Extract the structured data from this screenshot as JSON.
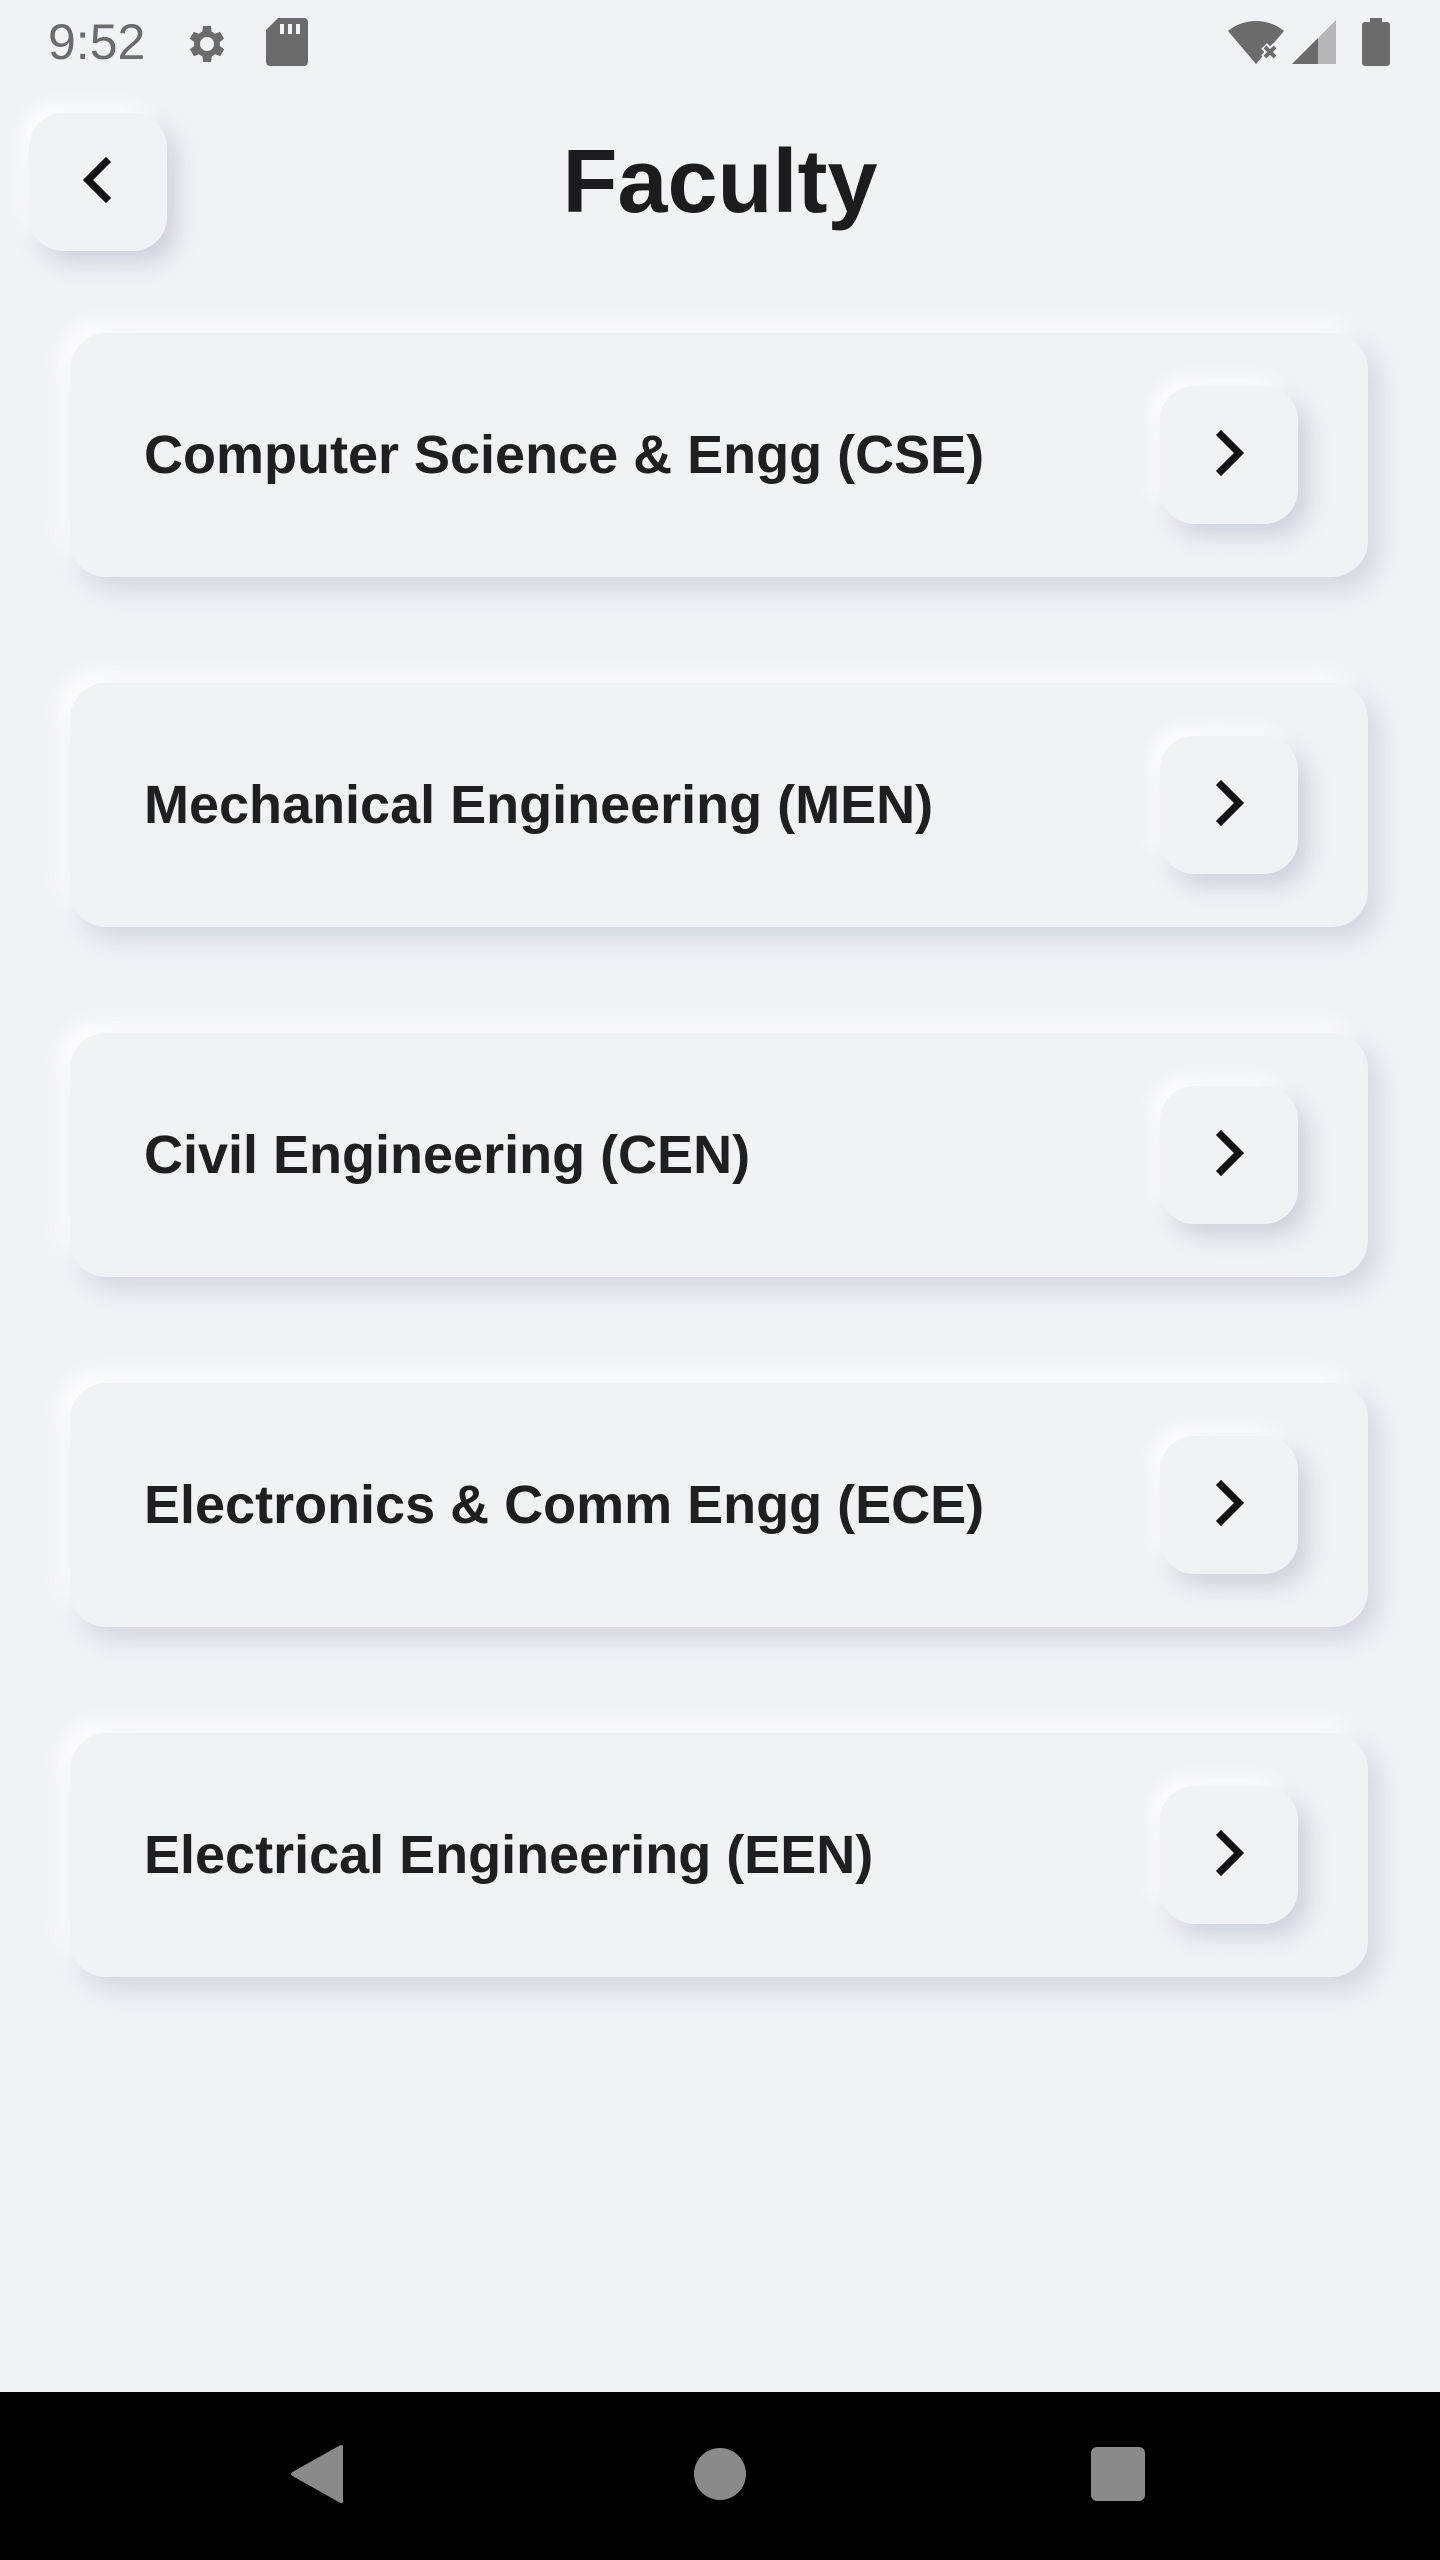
{
  "status_bar": {
    "time": "9:52",
    "icons": [
      "settings-gear-icon",
      "sd-card-icon",
      "wifi-off-icon",
      "cell-signal-icon",
      "battery-icon"
    ]
  },
  "header": {
    "title": "Faculty",
    "back_icon": "chevron-left-icon"
  },
  "departments": [
    {
      "label": "Computer Science & Engg (CSE)",
      "icon": "chevron-right-icon"
    },
    {
      "label": "Mechanical Engineering (MEN)",
      "icon": "chevron-right-icon"
    },
    {
      "label": "Civil Engineering (CEN)",
      "icon": "chevron-right-icon"
    },
    {
      "label": "Electronics & Comm Engg (ECE)",
      "icon": "chevron-right-icon"
    },
    {
      "label": "Electrical Engineering (EEN)",
      "icon": "chevron-right-icon"
    }
  ],
  "nav_bar": {
    "buttons": [
      "back-triangle-icon",
      "home-circle-icon",
      "recents-square-icon"
    ]
  },
  "colors": {
    "background": "#f1f2f6",
    "text": "#1c1c1e",
    "nav_bar": "#000000",
    "nav_icons": "#8a8a8a"
  }
}
